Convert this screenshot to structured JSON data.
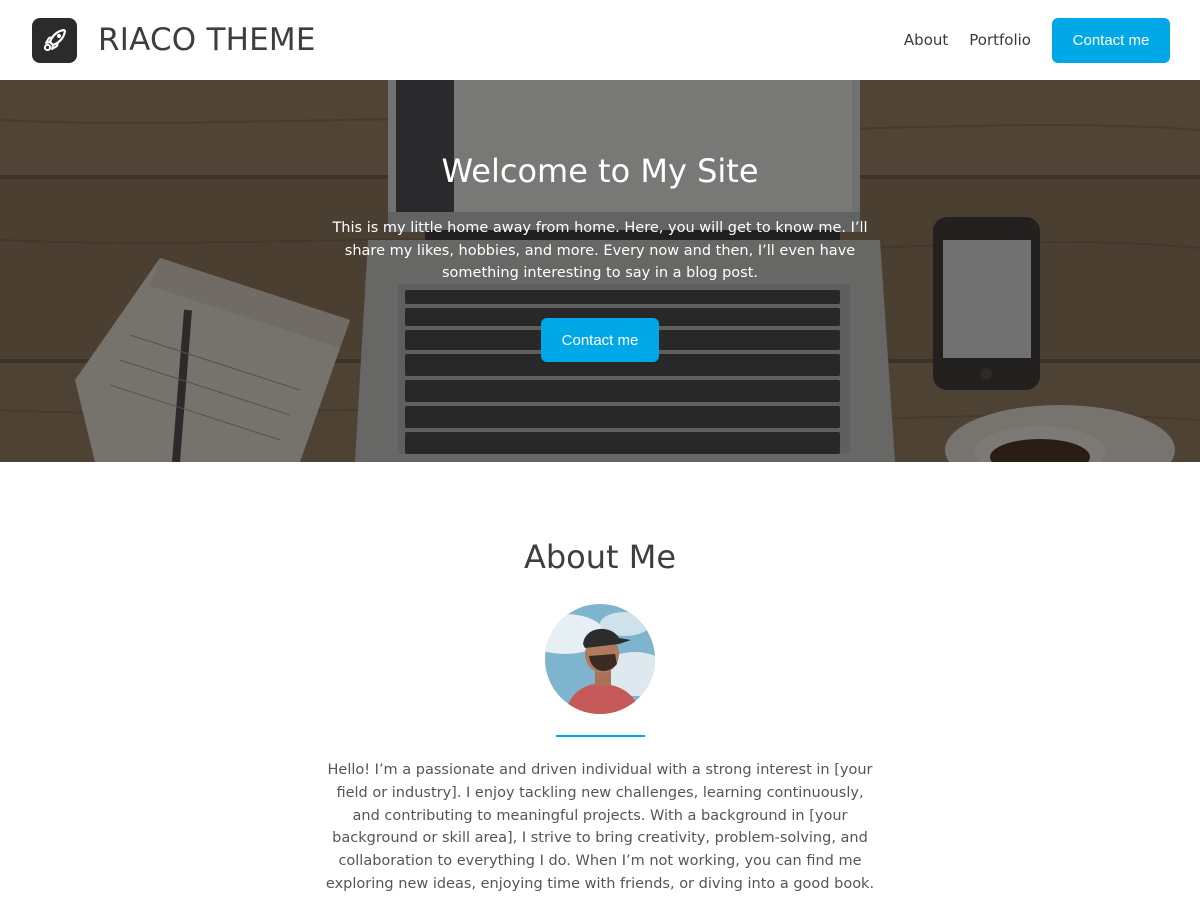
{
  "header": {
    "logo_icon": "rocket-icon",
    "site_title": "RIACO THEME",
    "nav": [
      {
        "label": "About"
      },
      {
        "label": "Portfolio"
      }
    ],
    "cta_label": "Contact me"
  },
  "hero": {
    "background": "laptop-on-wooden-desk-photo",
    "title": "Welcome to My Site",
    "text": "This is my little home away from home. Here, you will get to know me. I’ll share my likes, hobbies, and more. Every now and then, I’ll even have something interesting to say in a blog post.",
    "cta_label": "Contact me"
  },
  "about": {
    "title": "About Me",
    "avatar": "man-in-cap-profile-photo",
    "text": "Hello! I’m a passionate and driven individual with a strong interest in [your field or industry]. I enjoy tackling new challenges, learning continuously, and contributing to meaningful projects. With a background in [your background or skill area], I strive to bring creativity, problem-solving, and collaboration to everything I do. When I’m not working, you can find me exploring new ideas, enjoying time with friends, or diving into a good book."
  },
  "colors": {
    "accent": "#00a8e8",
    "title_text": "#3e3e3e",
    "body_text": "#555555"
  }
}
